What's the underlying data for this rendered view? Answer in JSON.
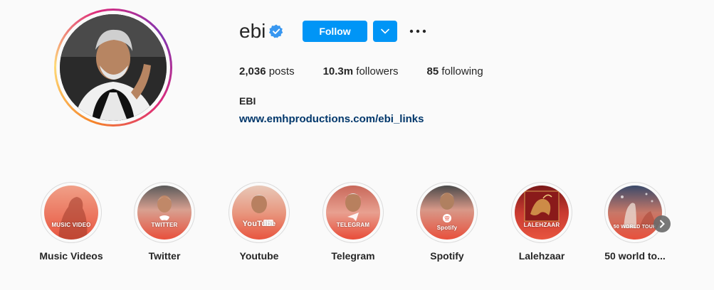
{
  "profile": {
    "username": "ebi",
    "verified": true,
    "follow_label": "Follow",
    "posts_count": "2,036",
    "posts_label": "posts",
    "followers_count": "10.3m",
    "followers_label": "followers",
    "following_count": "85",
    "following_label": "following",
    "full_name": "EBI",
    "link": "www.emhproductions.com/ebi_links"
  },
  "highlights": [
    {
      "label": "Music Videos",
      "overlay": "MUSIC VIDEO",
      "icon": "silhouette"
    },
    {
      "label": "Twitter",
      "overlay": "TWITTER",
      "icon": "twitter-bird-icon"
    },
    {
      "label": "Youtube",
      "overlay": "YouTube",
      "icon": "youtube-logo"
    },
    {
      "label": "Telegram",
      "overlay": "TELEGRAM",
      "icon": "telegram-icon"
    },
    {
      "label": "Spotify",
      "overlay": "Spotify",
      "icon": "spotify-icon"
    },
    {
      "label": "Lalehzaar",
      "overlay": "LALEHZAAR",
      "icon": "album-art"
    },
    {
      "label": "50 world to...",
      "overlay": "50 WORLD TOUR",
      "icon": "concert-photo"
    }
  ],
  "colors": {
    "accent": "#0095f6",
    "link": "#00376b",
    "verified": "#3897f0",
    "highlight_gradient_top": "#e8e0dc",
    "highlight_gradient_bottom": "#e85a4f"
  }
}
